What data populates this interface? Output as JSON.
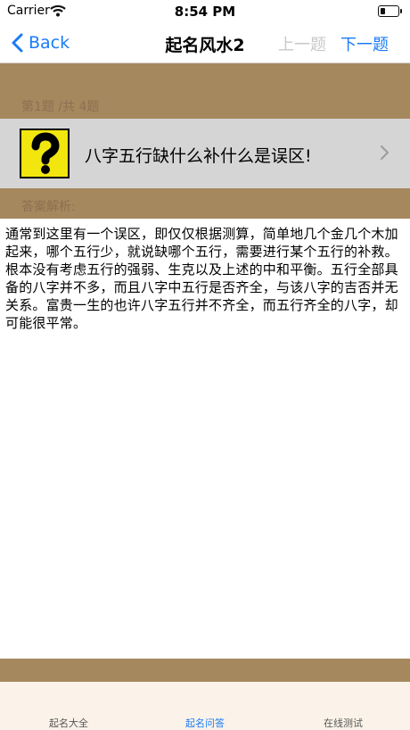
{
  "status": {
    "carrier": "Carrier",
    "time": "8:54 PM"
  },
  "nav": {
    "back_label": "Back",
    "title": "起名风水2",
    "prev_label": "上一题",
    "next_label": "下一题"
  },
  "question": {
    "counter": "第1题 /共 4题",
    "text": "八字五行缺什么补什么是误区!",
    "icon": "question-mark-icon"
  },
  "answer": {
    "label": "答案解析:",
    "text": "通常到这里有一个误区，即仅仅根据测算，简单地几个金几个木加起来，哪个五行少，就说缺哪个五行，需要进行某个五行的补救。根本没有考虑五行的强弱、生克以及上述的中和平衡。五行全部具备的八字并不多，而且八字中五行是否齐全，与该八字的吉否并无关系。富贵一生的也许八字五行并不齐全，而五行齐全的八字，却可能很平常。"
  },
  "tabs": [
    {
      "label": "起名大全",
      "active": false
    },
    {
      "label": "起名问答",
      "active": true
    },
    {
      "label": "在线测试",
      "active": false
    }
  ],
  "colors": {
    "accent": "#1a7cf5",
    "brown": "#a6885e",
    "tabbar_bg": "#fbf3e9",
    "question_bg": "#d5d5d5"
  }
}
